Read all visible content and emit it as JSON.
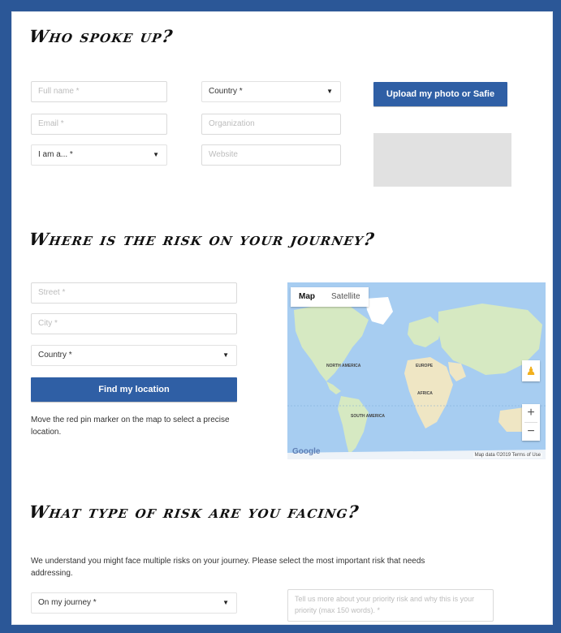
{
  "sections": {
    "who": "Who spoke up?",
    "where": "Where is the risk on your journey?",
    "type": "What type of risk are you facing?"
  },
  "who_form": {
    "full_name_placeholder": "Full name *",
    "email_placeholder": "Email *",
    "i_am_select": "I am a... *",
    "country_select": "Country *",
    "organization_placeholder": "Organization",
    "website_placeholder": "Website",
    "upload_button": "Upload my photo or Safie"
  },
  "where_form": {
    "street_placeholder": "Street *",
    "city_placeholder": "City *",
    "country_select": "Country *",
    "find_button": "Find my location",
    "hint": "Move the red pin marker on the map to select a precise location."
  },
  "map": {
    "tabs": [
      "Map",
      "Satellite"
    ],
    "active_tab": "Map",
    "zoom_in": "+",
    "zoom_out": "−",
    "google": "Google",
    "attribution": "Map data ©2019  Terms of Use",
    "labels": {
      "north_america": "NORTH AMERICA",
      "europe": "EUROPE",
      "africa": "AFRICA",
      "south_america": "SOUTH AMERICA"
    }
  },
  "type_form": {
    "intro": "We understand you might face multiple risks on your journey. Please select the most important risk that needs addressing.",
    "journey_select": "On my journey *",
    "details_placeholder": "Tell us more about your priority risk and why this is your priority (max 150 words). *"
  },
  "colors": {
    "frame": "#2b5797",
    "button": "#2f5fa5",
    "photo_placeholder": "#e1e1e1",
    "water": "#a7cdf1",
    "land": "#d6e9c2"
  }
}
